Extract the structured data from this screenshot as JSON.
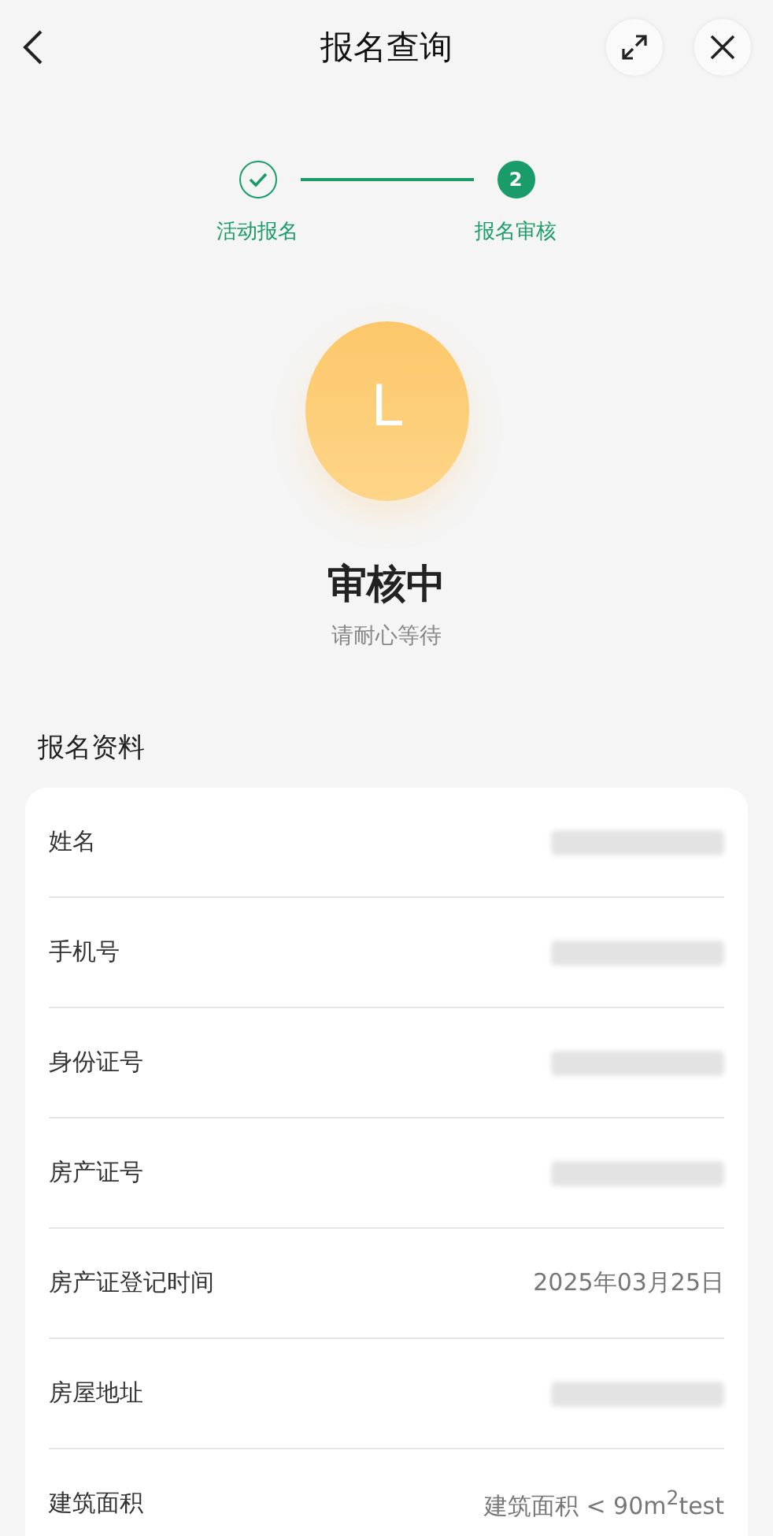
{
  "header": {
    "title": "报名查询"
  },
  "steps": [
    {
      "label": "活动报名",
      "done": true
    },
    {
      "label": "报名审核",
      "number": "2",
      "done": false
    }
  ],
  "status": {
    "avatar_letter": "L",
    "title": "审核中",
    "subtitle": "请耐心等待"
  },
  "section_title": "报名资料",
  "fields": [
    {
      "label": "姓名",
      "kind": "blurred"
    },
    {
      "label": "手机号",
      "kind": "blurred"
    },
    {
      "label": "身份证号",
      "kind": "blurred"
    },
    {
      "label": "房产证号",
      "kind": "blurred"
    },
    {
      "label": "房产证登记时间",
      "kind": "text",
      "value": "2025年03月25日"
    },
    {
      "label": "房屋地址",
      "kind": "blurred"
    },
    {
      "label": "建筑面积",
      "kind": "text",
      "value": "建筑面积 < 90m$^{2}$test"
    }
  ]
}
